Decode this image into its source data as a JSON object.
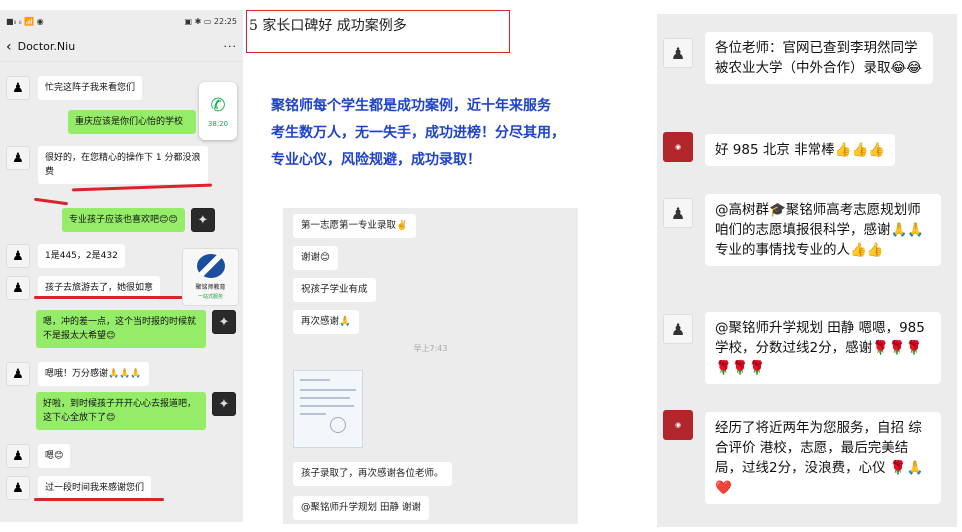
{
  "title_box": {
    "text": "5 家长口碑好  成功案例多"
  },
  "headline": {
    "lines": [
      "聚铭师每个学生都是成功案例，近十年来服务",
      "考生数万人，无一失手，成功进榜！分尽其用，",
      "专业心仪，风险规避，成功录取！"
    ]
  },
  "phone": {
    "status_left": "■ᵢₗ ᵢₗ 📶 ◉",
    "status_right": "▣ ✱ ▭ 22:25",
    "back_icon": "‹",
    "contact": "Doctor.Niu",
    "more": "···",
    "call": {
      "icon": "phone-icon",
      "time": "38:20"
    },
    "messages": [
      {
        "side": "left",
        "text": "忙完这阵子我来看您们"
      },
      {
        "side": "right",
        "text": "重庆应该是你们心怡的学校"
      },
      {
        "side": "left",
        "text": "很好的，在您精心的操作下 1 分都没浪费"
      },
      {
        "side": "right",
        "text": "专业孩子应该也喜欢吧😊😊"
      },
      {
        "side": "left",
        "text": "1是445，2是432"
      },
      {
        "side": "left",
        "text": "孩子去旅游去了，她很如意"
      },
      {
        "side": "right",
        "text": "嗯，冲的差一点，这个当时报的时候就不是报太大希望😊"
      },
      {
        "side": "left",
        "text": "嗯哦！万分感谢🙏🙏🙏"
      },
      {
        "side": "right",
        "text": "好啦，到时候孩子开开心心去报道吧，这下心全放下了😊"
      },
      {
        "side": "left",
        "text": "嗯😊"
      },
      {
        "side": "left",
        "text": "过一段时间我来感谢您们"
      }
    ],
    "logo": {
      "name": "聚铭师教育",
      "sub": "一站式服务"
    }
  },
  "middle": {
    "messages": [
      "第一志愿第一专业录取✌️",
      "谢谢😊",
      "祝孩子学业有成",
      "再次感谢🙏",
      "孩子录取了，再次感谢各位老师。",
      "@聚铭师升学规划 田静  谢谢"
    ],
    "time": "早上7:43"
  },
  "right": {
    "avatar_red_label": "聚铭师升学规划",
    "messages": [
      "各位老师：官网已查到李玥然同学被农业大学（中外合作）录取😂😂",
      "好 985 北京 非常棒👍👍👍",
      "@高树群🎓聚铭师高考志愿规划师 咱们的志愿填报很科学，感谢🙏🙏专业的事情找专业的人👍👍",
      "@聚铭师升学规划 田静 嗯嗯，985学校，分数过线2分，感谢🌹🌹🌹🌹🌹🌹",
      "经历了将近两年为您服务，自招 综合评价 港校，志愿，最后完美结局，过线2分，没浪费，心仪 🌹🙏❤️"
    ]
  },
  "colors": {
    "accent_red": "#d8252c",
    "headline_blue": "#1f43c8",
    "wechat_green": "#95ec69"
  }
}
